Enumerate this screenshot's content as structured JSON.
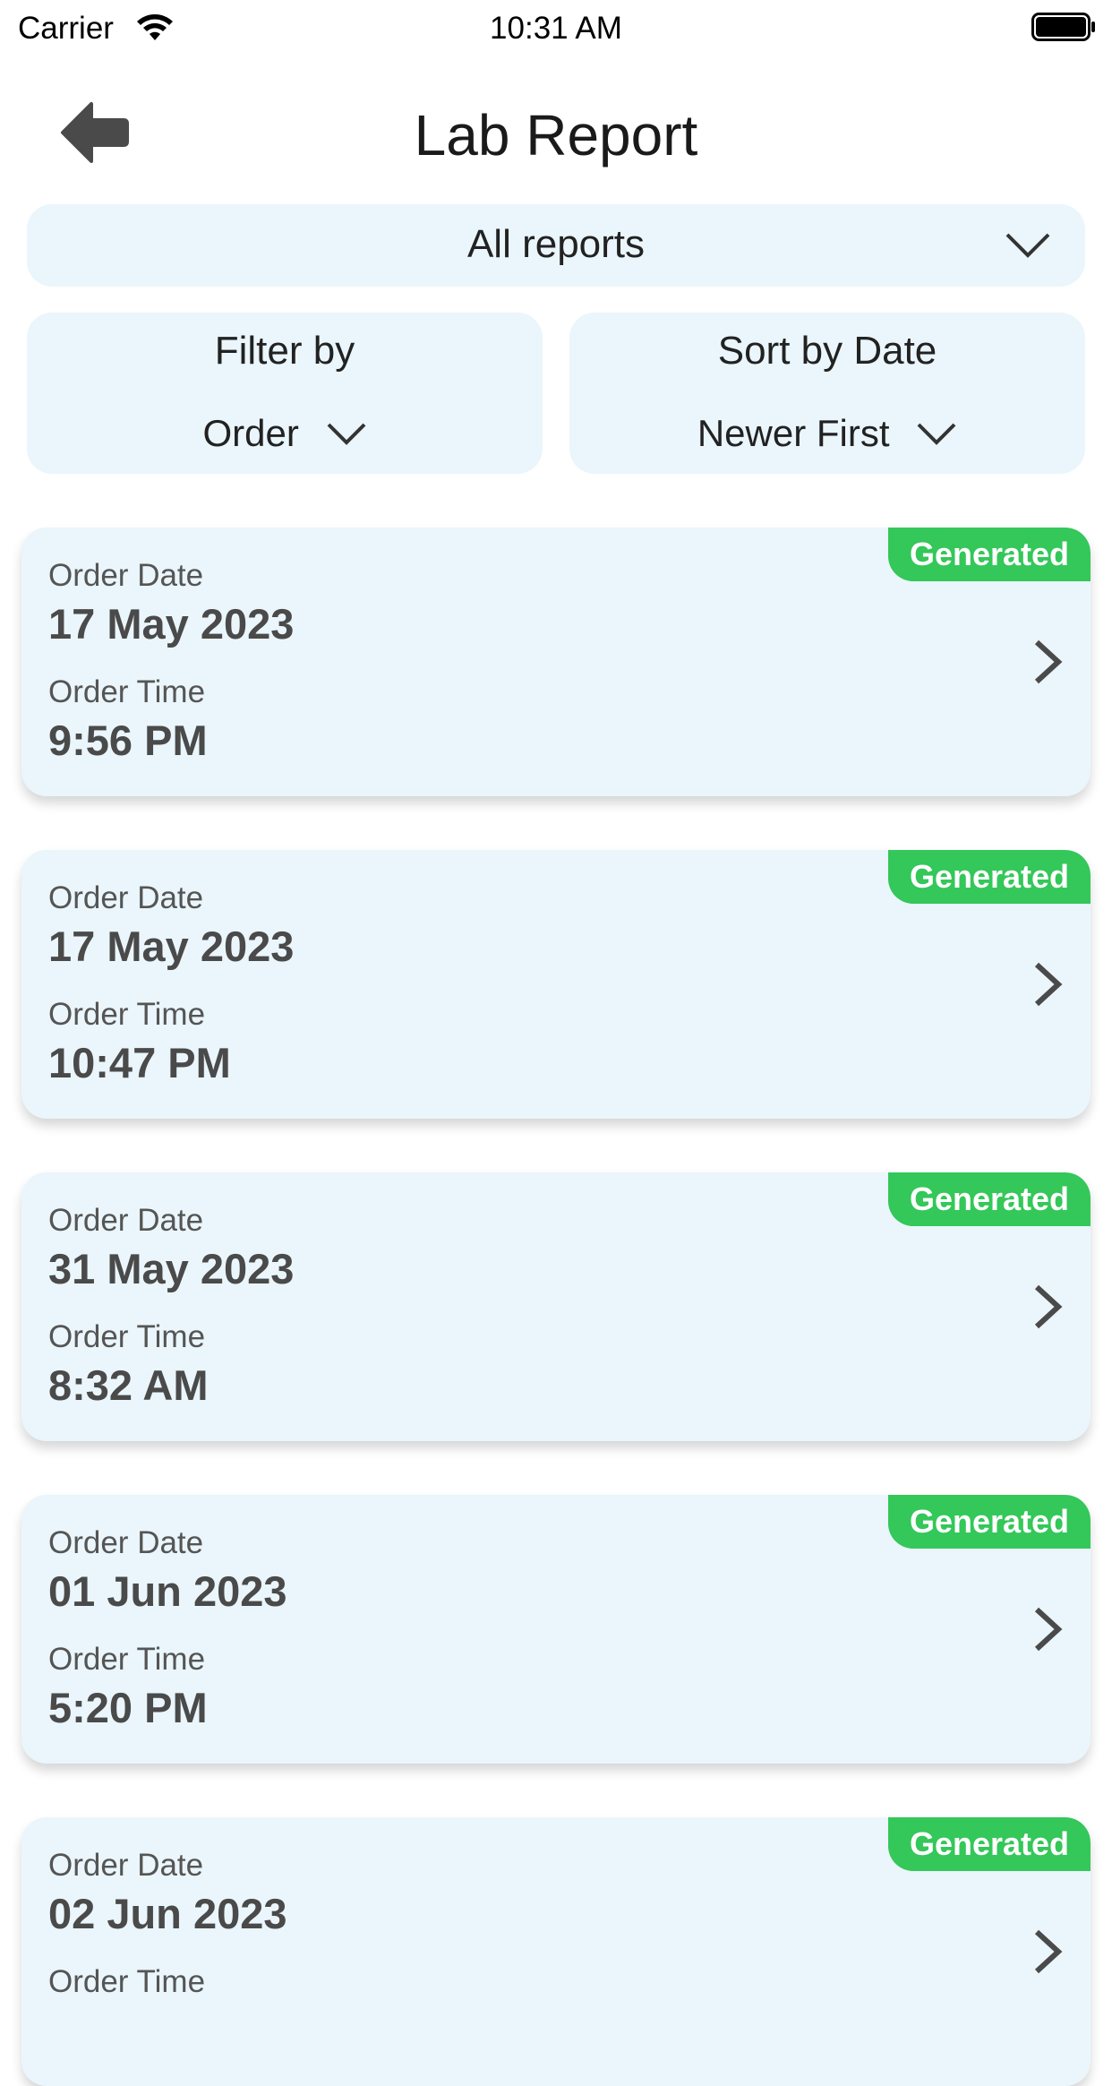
{
  "status_bar": {
    "carrier": "Carrier",
    "time": "10:31 AM"
  },
  "header": {
    "title": "Lab Report",
    "back_icon": "back-arrow-icon"
  },
  "report_type_select": {
    "selected": "All reports"
  },
  "filter": {
    "label": "Filter by",
    "value": "Order"
  },
  "sort": {
    "label": "Sort by Date",
    "value": "Newer First"
  },
  "colors": {
    "panel_bg": "#eaf6fb",
    "badge_green": "#34c759",
    "text_dark": "#4a4a4a"
  },
  "orders": [
    {
      "status": "Generated",
      "date_label": "Order Date",
      "date": "17 May 2023",
      "time_label": "Order Time",
      "time": "9:56 PM"
    },
    {
      "status": "Generated",
      "date_label": "Order Date",
      "date": "17 May 2023",
      "time_label": "Order Time",
      "time": "10:47 PM"
    },
    {
      "status": "Generated",
      "date_label": "Order Date",
      "date": "31 May 2023",
      "time_label": "Order Time",
      "time": "8:32 AM"
    },
    {
      "status": "Generated",
      "date_label": "Order Date",
      "date": "01 Jun 2023",
      "time_label": "Order Time",
      "time": "5:20 PM"
    },
    {
      "status": "Generated",
      "date_label": "Order Date",
      "date": "02 Jun 2023",
      "time_label": "Order Time",
      "time": ""
    }
  ]
}
